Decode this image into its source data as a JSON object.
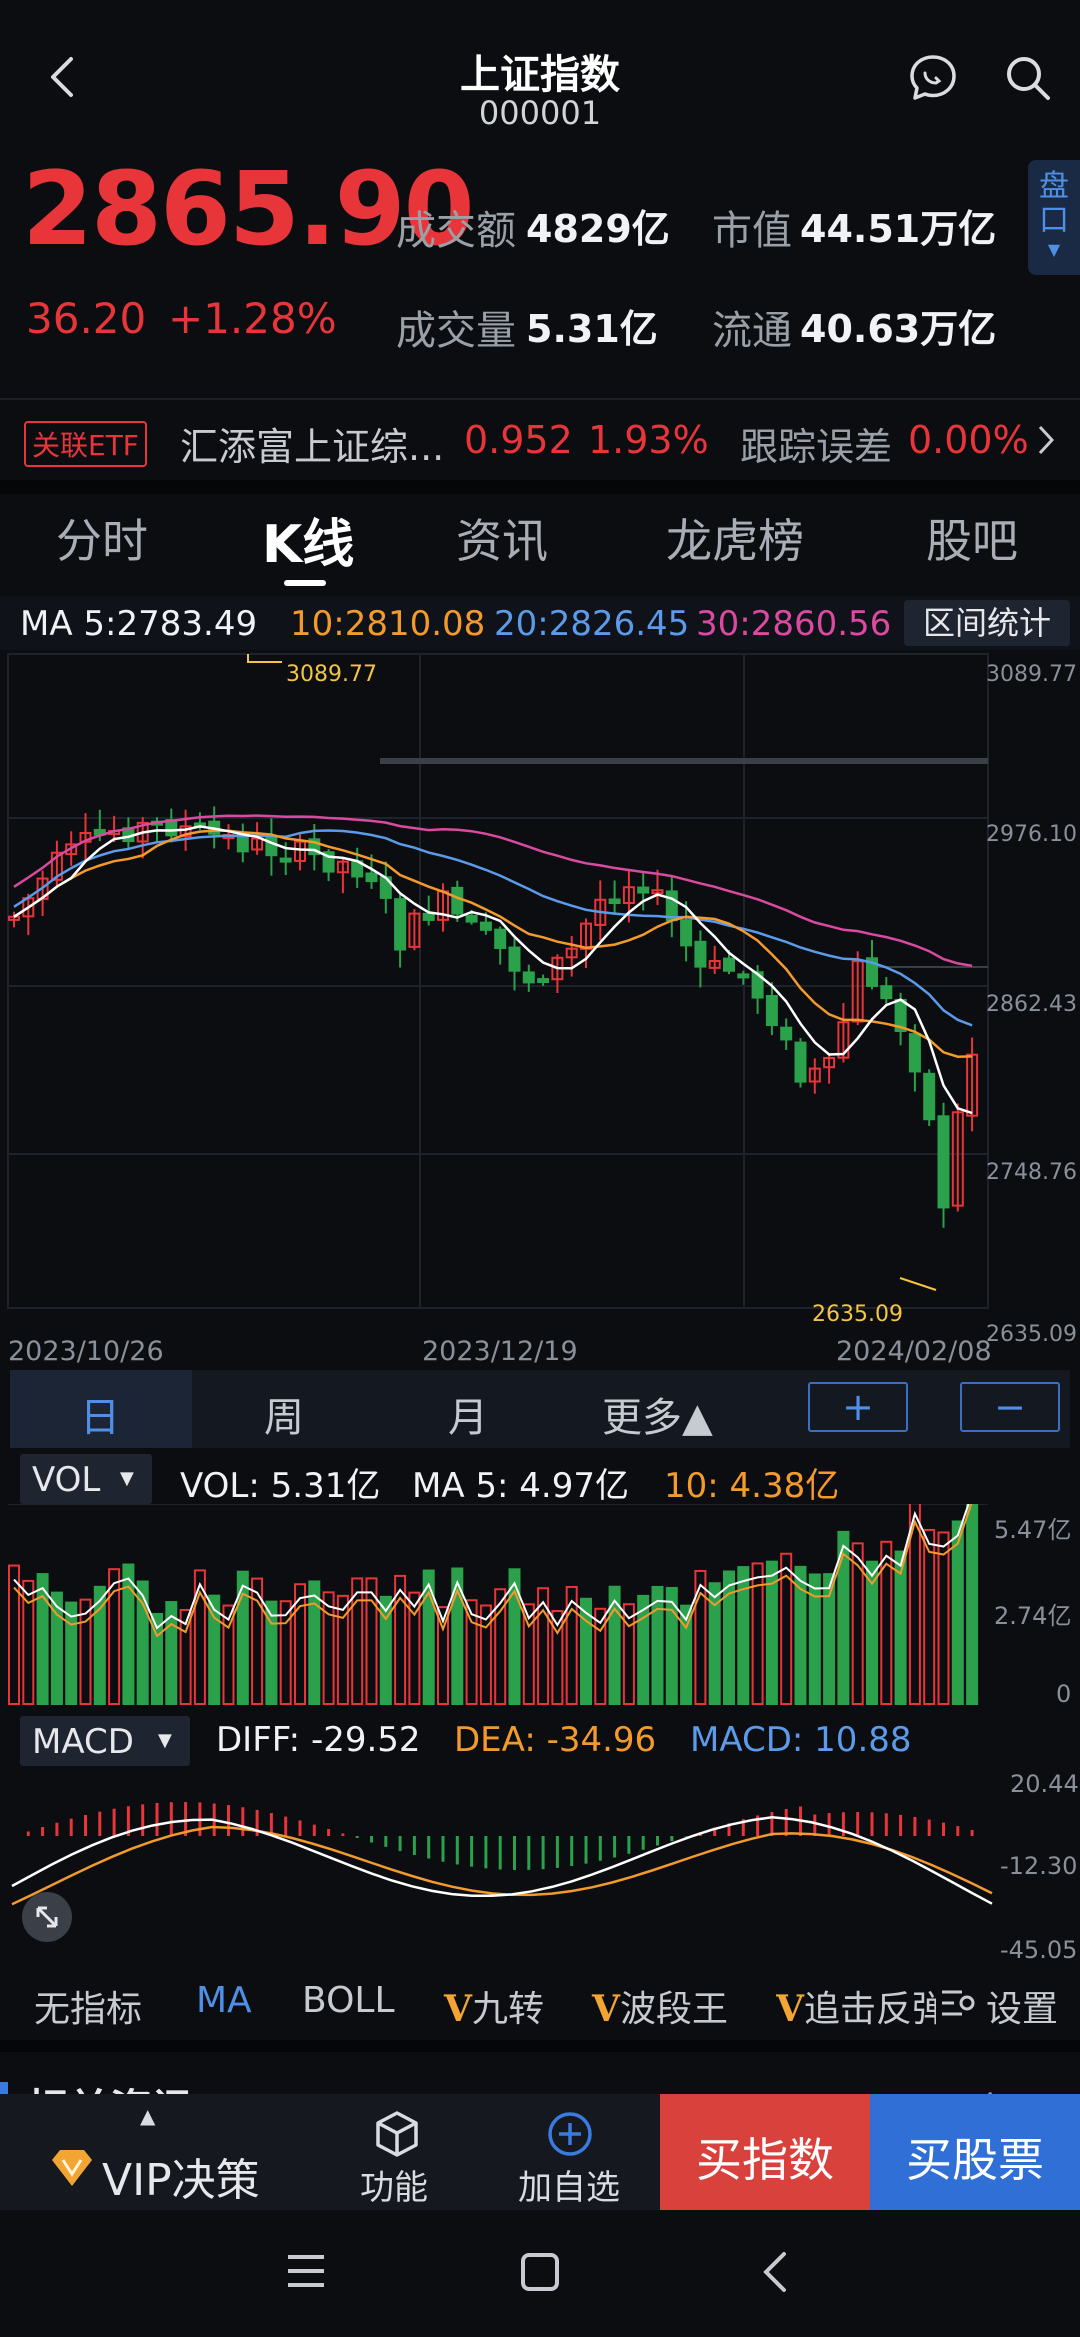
{
  "header": {
    "title": "上证指数",
    "code": "000001"
  },
  "quote": {
    "price": "2865.90",
    "change": "36.20",
    "change_pct": "+1.28%",
    "turnover_label": "成交额",
    "turnover_value": "4829亿",
    "volume_label": "成交量",
    "volume_value": "5.31亿",
    "mktcap_label": "市值",
    "mktcap_value": "44.51万亿",
    "float_label": "流通",
    "float_value": "40.63万亿",
    "side_tab": "盘口"
  },
  "etf": {
    "badge": "关联ETF",
    "name": "汇添富上证综...",
    "price": "0.952",
    "pct": "1.93%",
    "tracking_label": "跟踪误差",
    "tracking_value": "0.00%"
  },
  "tabs": [
    "分时",
    "K线",
    "资讯",
    "龙虎榜",
    "股吧"
  ],
  "ma_bar": {
    "ma5": "MA 5:2783.49",
    "ma10": "10:2810.08",
    "ma20": "20:2826.45",
    "ma30": "30:2860.56",
    "range_stat": "区间统计"
  },
  "kline": {
    "y_labels": [
      "3089.77",
      "2976.10",
      "2862.43",
      "2748.76",
      "2635.09"
    ],
    "high_mark": "3089.77",
    "low_mark": "2635.09",
    "x_labels": [
      "2023/10/26",
      "2023/12/19",
      "2024/02/08"
    ]
  },
  "periods": {
    "day": "日",
    "week": "周",
    "month": "月",
    "more": "更多▲",
    "zoom_in": "+",
    "zoom_out": "−"
  },
  "vol_bar": {
    "selector": "VOL",
    "vol": "VOL: 5.31亿",
    "ma5": "MA 5: 4.97亿",
    "ma10": "10: 4.38亿",
    "y_labels": [
      "5.47亿",
      "2.74亿",
      "0"
    ]
  },
  "macd_bar": {
    "selector": "MACD",
    "diff": "DIFF: -29.52",
    "dea": "DEA: -34.96",
    "macd": "MACD: 10.88",
    "y_labels": [
      "20.44",
      "-12.30",
      "-45.05"
    ]
  },
  "indicators": {
    "none": "无指标",
    "ma": "MA",
    "boll": "BOLL",
    "v1": "九转",
    "v2": "波段王",
    "v3": "追击反弹",
    "settings": "设置",
    "v_mark": "V"
  },
  "news_peek": {
    "title": "相关资讯",
    "more": "更多"
  },
  "bottom_bar": {
    "vip": "VIP决策",
    "func": "功能",
    "watch": "加自选",
    "buy_index": "买指数",
    "buy_stock": "买股票"
  },
  "colors": {
    "up": "#e8353a",
    "down": "#2aa14a",
    "ma5": "#ffffff",
    "ma10": "#f39a2c",
    "ma20": "#5b9be9",
    "ma30": "#d94aa0",
    "buy_index_bg": "#d9423c",
    "buy_stock_bg": "#2f6fd6"
  }
}
